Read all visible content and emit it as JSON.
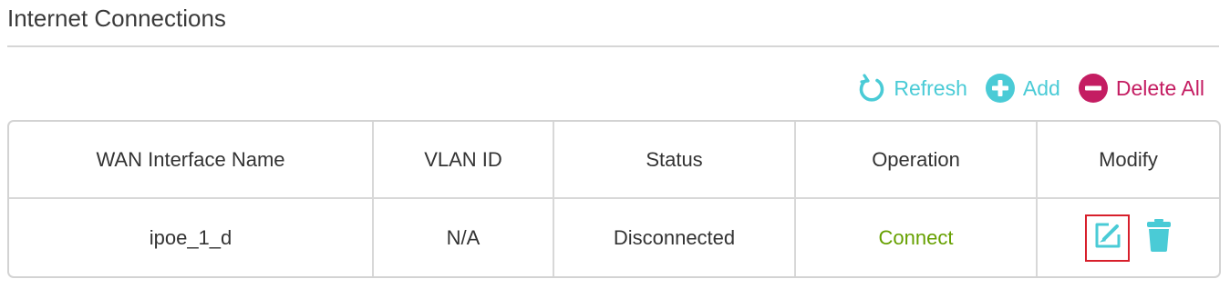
{
  "section": {
    "title": "Internet Connections"
  },
  "toolbar": {
    "refresh_label": "Refresh",
    "refresh_icon": "refresh-icon",
    "add_label": "Add",
    "add_icon": "plus-circle-icon",
    "delete_all_label": "Delete All",
    "delete_all_icon": "minus-circle-icon"
  },
  "table": {
    "columns": [
      "WAN Interface Name",
      "VLAN ID",
      "Status",
      "Operation",
      "Modify"
    ],
    "rows": [
      {
        "wan_interface_name": "ipoe_1_d",
        "vlan_id": "N/A",
        "status": "Disconnected",
        "operation": "Connect",
        "modify_icons": [
          "edit-icon",
          "trash-icon"
        ]
      }
    ]
  },
  "colors": {
    "accent_teal": "#4acbd6",
    "danger_pink": "#c41d62",
    "connect_green": "#66a000",
    "highlight_red": "#d71f2b"
  }
}
